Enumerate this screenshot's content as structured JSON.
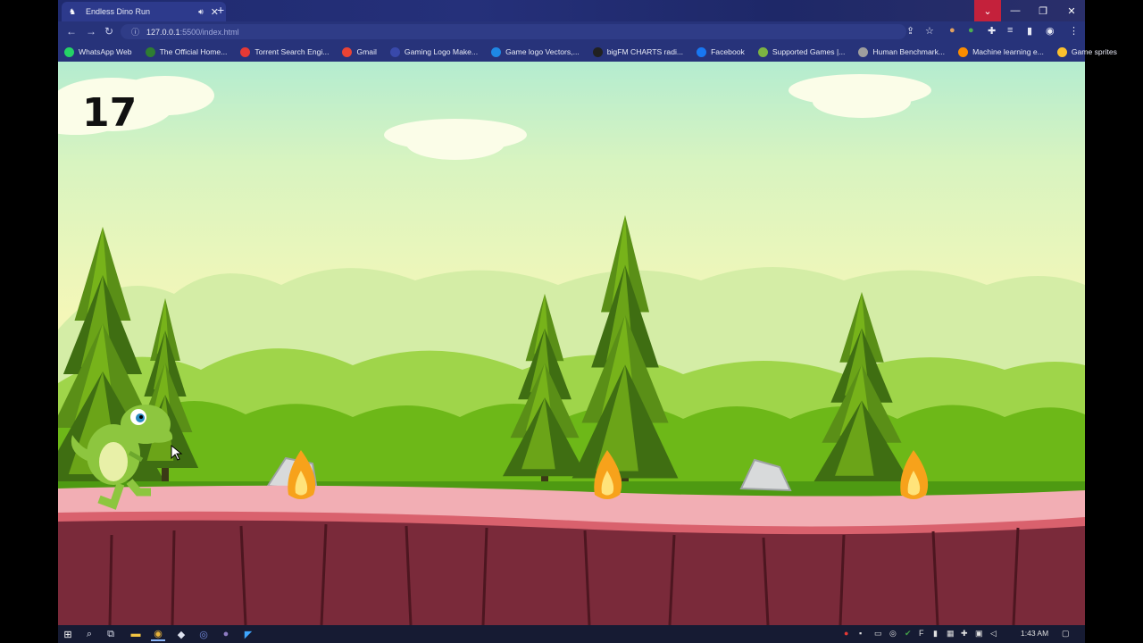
{
  "browser": {
    "tab_title": "Endless Dino Run",
    "new_tab": "+",
    "url_host": "127.0.0.1",
    "url_rest": ":5500/index.html",
    "bookmarks": [
      {
        "label": "WhatsApp Web",
        "color": "#25d366"
      },
      {
        "label": "The Official Home...",
        "color": "#2e7d32"
      },
      {
        "label": "Torrent Search Engi...",
        "color": "#e53935"
      },
      {
        "label": "Gmail",
        "color": "#ea4335"
      },
      {
        "label": "Gaming Logo Make...",
        "color": "#3949ab"
      },
      {
        "label": "Game logo Vectors,...",
        "color": "#1e88e5"
      },
      {
        "label": "bigFM CHARTS radi...",
        "color": "#212121"
      },
      {
        "label": "Facebook",
        "color": "#1877f2"
      },
      {
        "label": "Supported Games |...",
        "color": "#7cb342"
      },
      {
        "label": "Human Benchmark...",
        "color": "#9e9e9e"
      },
      {
        "label": "Machine learning e...",
        "color": "#fb8c00"
      },
      {
        "label": "Game sprites",
        "color": "#fbc02d"
      }
    ]
  },
  "game": {
    "score": "17"
  },
  "taskbar": {
    "time": "1:43 AM"
  },
  "colors": {
    "ground_top": "#f2aeb4",
    "ground_dirt": "#7a2a3a",
    "pine_dark": "#3f6e12",
    "pine_light": "#8fd11e"
  }
}
